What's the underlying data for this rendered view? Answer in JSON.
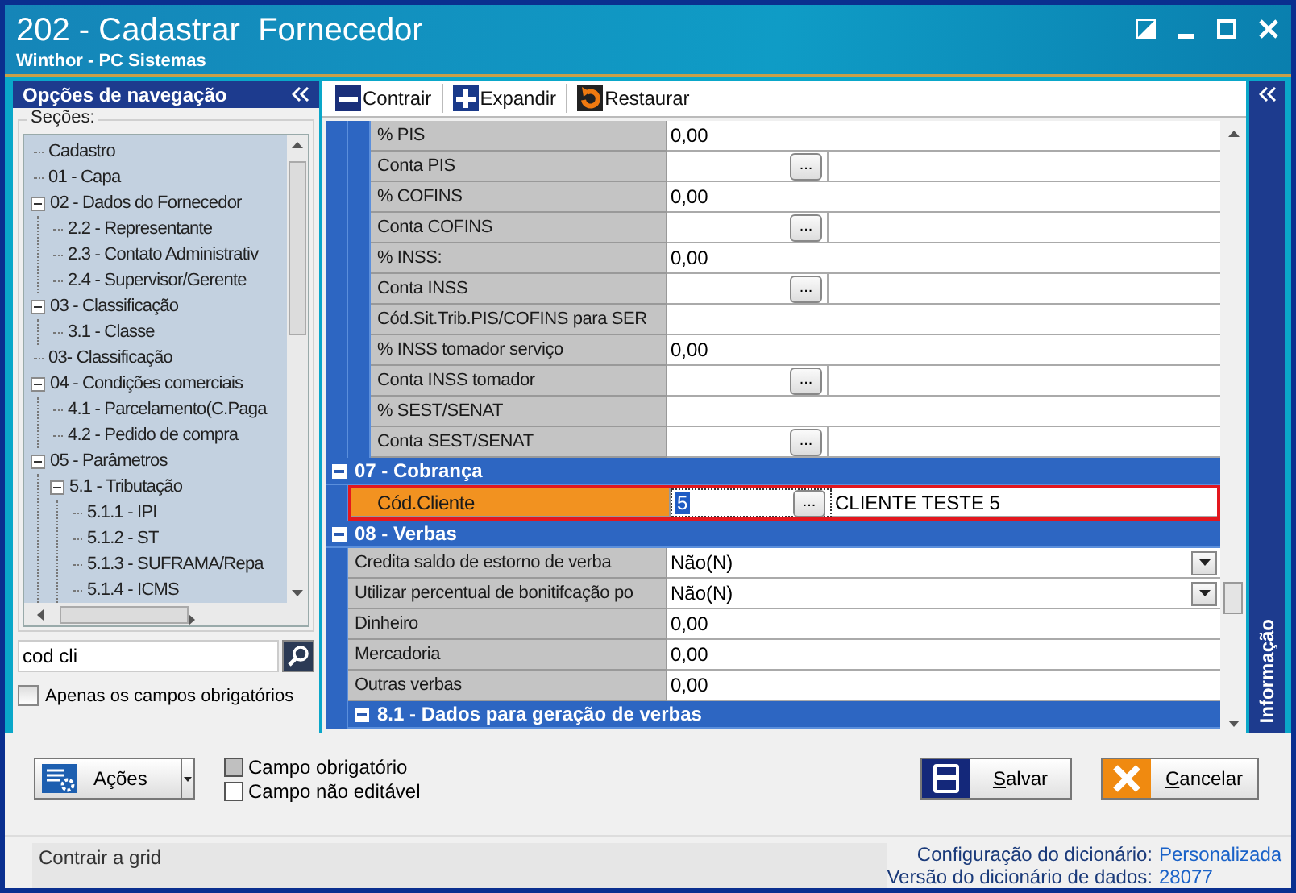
{
  "window": {
    "title": "202 - Cadastrar  Fornecedor",
    "subtitle": "Winthor - PC Sistemas"
  },
  "navigation": {
    "title": "Opções de navegação",
    "sections_label": "Seções:",
    "tree": [
      {
        "label": "Cadastro"
      },
      {
        "label": "01 - Capa"
      },
      {
        "label": "02 - Dados do Fornecedor",
        "expanded": true,
        "children": [
          {
            "label": "2.2 - Representante"
          },
          {
            "label": "2.3 - Contato Administrativ"
          },
          {
            "label": "2.4 - Supervisor/Gerente"
          }
        ]
      },
      {
        "label": "03 - Classificação",
        "expanded": true,
        "children": [
          {
            "label": "3.1 - Classe"
          }
        ]
      },
      {
        "label": "03- Classificação"
      },
      {
        "label": "04 - Condições comerciais",
        "expanded": true,
        "children": [
          {
            "label": "4.1 - Parcelamento(C.Paga"
          },
          {
            "label": "4.2 - Pedido de compra"
          }
        ]
      },
      {
        "label": "05 - Parâmetros",
        "expanded": true,
        "children": [
          {
            "label": "5.1 - Tributação",
            "expanded": true,
            "children": [
              {
                "label": "5.1.1 - IPI"
              },
              {
                "label": "5.1.2 - ST"
              },
              {
                "label": "5.1.3 - SUFRAMA/Repa"
              },
              {
                "label": "5.1.4 - ICMS"
              }
            ]
          }
        ]
      }
    ],
    "search": {
      "value": "cod cli"
    },
    "required_only": {
      "label": "Apenas os campos obrigatórios",
      "checked": false
    }
  },
  "toolbar": [
    {
      "label": "Contrair",
      "kind": "collapse"
    },
    {
      "label": "Expandir",
      "kind": "expand"
    },
    {
      "label": "Restaurar",
      "kind": "restore"
    }
  ],
  "grid": {
    "items": [
      {
        "kind": "group",
        "children": [
          {
            "kind": "group",
            "children": [
              {
                "kind": "text",
                "label": "% PIS",
                "value": "0,00",
                "selected": false
              },
              {
                "kind": "lookup",
                "label": "Conta PIS",
                "button_label": "...",
                "selected": false
              },
              {
                "kind": "text",
                "label": "% COFINS",
                "value": "0,00",
                "selected": false
              },
              {
                "kind": "lookup",
                "label": "Conta COFINS",
                "button_label": "...",
                "selected": false
              },
              {
                "kind": "text",
                "label": "% INSS:",
                "value": "0,00",
                "selected": false
              },
              {
                "kind": "lookup",
                "label": "Conta INSS",
                "button_label": "...",
                "selected": false
              },
              {
                "kind": "text",
                "label": "Cód.Sit.Trib.PIS/COFINS para SER",
                "selected": false
              },
              {
                "kind": "text",
                "label": "% INSS tomador serviço",
                "value": "0,00",
                "selected": false
              },
              {
                "kind": "lookup",
                "label": "Conta INSS tomador",
                "button_label": "...",
                "selected": false
              },
              {
                "kind": "text",
                "label": "% SEST/SENAT",
                "selected": false
              },
              {
                "kind": "lookup",
                "label": "Conta SEST/SENAT",
                "button_label": "...",
                "selected": false
              }
            ]
          }
        ]
      },
      {
        "kind": "section",
        "title": "07 - Cobrança",
        "expanded": true,
        "children": [
          {
            "kind": "lookup",
            "label": "Cód.Cliente",
            "value": "5",
            "button_label": "...",
            "description": "CLIENTE TESTE 5",
            "selected": true
          }
        ]
      },
      {
        "kind": "section",
        "title": "08 - Verbas",
        "expanded": true,
        "children": [
          {
            "kind": "dropdown",
            "label": "Credita saldo de estorno de verba",
            "value": "Não(N)",
            "selected": false
          },
          {
            "kind": "dropdown",
            "label": "Utilizar percentual de bonitifcação po",
            "value": "Não(N)",
            "selected": false
          },
          {
            "kind": "text",
            "label": "Dinheiro",
            "value": "0,00",
            "selected": false
          },
          {
            "kind": "text",
            "label": "Mercadoria",
            "value": "0,00",
            "selected": false
          },
          {
            "kind": "text",
            "label": "Outras verbas",
            "value": "0,00",
            "selected": false
          },
          {
            "kind": "section",
            "title": "8.1 - Dados para geração de verbas",
            "expanded": true
          }
        ]
      }
    ]
  },
  "info_panel": {
    "label": "Informação"
  },
  "actions": {
    "label": "Ações"
  },
  "legend": [
    {
      "label": "Campo obrigatório",
      "kind": "required"
    },
    {
      "label": "Campo não editável",
      "kind": "readonly"
    }
  ],
  "buttons": [
    {
      "label": "Salvar",
      "kind": "save"
    },
    {
      "label": "Cancelar",
      "kind": "cancel"
    }
  ],
  "status_bar": {
    "hint": "Contrair a grid",
    "info": [
      {
        "label": "Configuração do dicionário:",
        "value": "Personalizada"
      },
      {
        "label": "Versão do dicionário de dados:",
        "value": "28077"
      }
    ]
  }
}
